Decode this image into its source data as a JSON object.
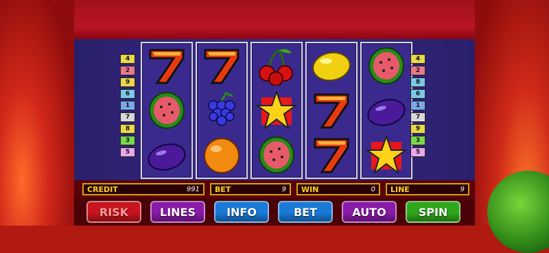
{
  "paylines": {
    "left": [
      {
        "num": "4",
        "color": "#e8d84a"
      },
      {
        "num": "2",
        "color": "#e87a8a"
      },
      {
        "num": "9",
        "color": "#e8d84a"
      },
      {
        "num": "6",
        "color": "#7ac8e8"
      },
      {
        "num": "1",
        "color": "#7aa8e8"
      },
      {
        "num": "7",
        "color": "#d8d8d8"
      },
      {
        "num": "8",
        "color": "#e8d84a"
      },
      {
        "num": "3",
        "color": "#7ad84a"
      },
      {
        "num": "5",
        "color": "#e8a8e8"
      }
    ],
    "right": [
      {
        "num": "4",
        "color": "#e8d84a"
      },
      {
        "num": "2",
        "color": "#e87a8a"
      },
      {
        "num": "8",
        "color": "#7ac8e8"
      },
      {
        "num": "6",
        "color": "#7ac8e8"
      },
      {
        "num": "1",
        "color": "#7aa8e8"
      },
      {
        "num": "7",
        "color": "#d8d8d8"
      },
      {
        "num": "9",
        "color": "#e8d84a"
      },
      {
        "num": "3",
        "color": "#7ad84a"
      },
      {
        "num": "5",
        "color": "#e8a8e8"
      }
    ]
  },
  "reels": [
    [
      "seven-icon",
      "watermelon-icon",
      "plum-icon"
    ],
    [
      "seven-icon",
      "grapes-icon",
      "orange-icon"
    ],
    [
      "cherries-icon",
      "star-icon",
      "watermelon-icon"
    ],
    [
      "lemon-icon",
      "seven-icon",
      "seven-icon"
    ],
    [
      "watermelon-icon",
      "plum-icon",
      "star-icon"
    ]
  ],
  "status": {
    "credit_label": "CREDIT",
    "credit_value": "991",
    "bet_label": "BET",
    "bet_value": "9",
    "win_label": "WIN",
    "win_value": "0",
    "line_label": "LINE",
    "line_value": "9"
  },
  "buttons": [
    {
      "label": "RISK",
      "color": "#c8141e",
      "text": "#ff9a9a",
      "name": "risk-button"
    },
    {
      "label": "LINES",
      "color": "#8a1aa8",
      "text": "#ffffff",
      "name": "lines-button"
    },
    {
      "label": "INFO",
      "color": "#1a7ad8",
      "text": "#ffffff",
      "name": "info-button"
    },
    {
      "label": "BET",
      "color": "#1a7ad8",
      "text": "#ffffff",
      "name": "bet-button"
    },
    {
      "label": "AUTO",
      "color": "#8a1aa8",
      "text": "#ffffff",
      "name": "auto-button"
    },
    {
      "label": "SPIN",
      "color": "#2ea81a",
      "text": "#ffffff",
      "name": "spin-button"
    }
  ]
}
